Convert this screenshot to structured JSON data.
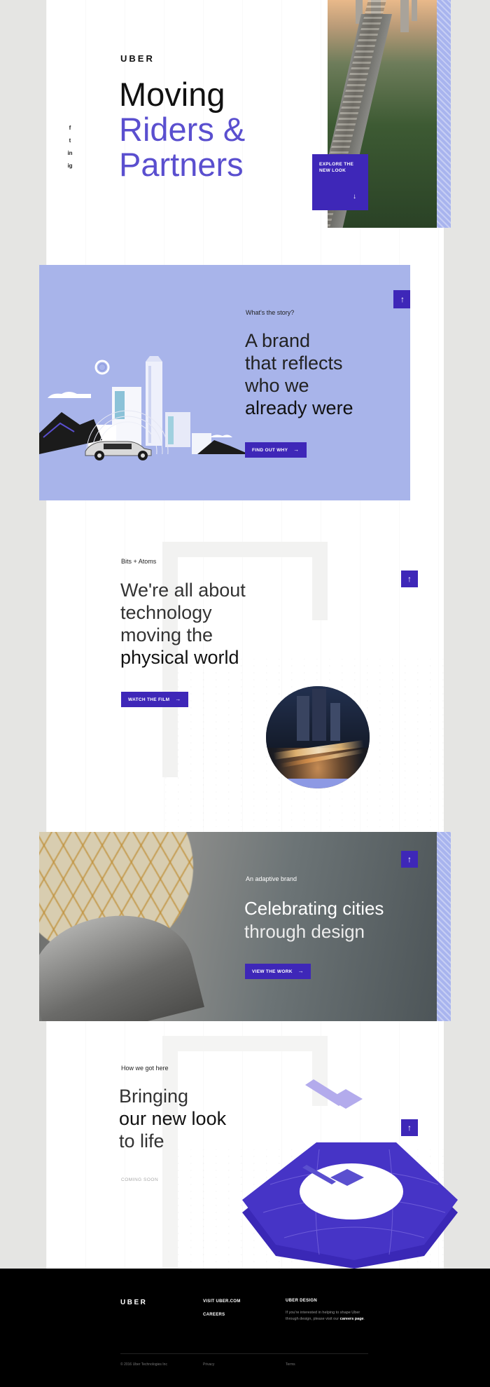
{
  "hero": {
    "brand": "UBER",
    "title_line1": "Moving",
    "title_line2": "Riders &",
    "title_line3": "Partners",
    "explore_label": "EXPLORE THE NEW LOOK",
    "explore_arrow": "↓",
    "social_icons": [
      "facebook-icon",
      "twitter-icon",
      "linkedin-icon",
      "instagram-icon"
    ],
    "social_glyphs": [
      "f",
      "t",
      "in",
      "ig"
    ]
  },
  "story": {
    "eyebrow": "What's the story?",
    "line1": "A brand",
    "line2": "that reflects",
    "line3": "who we",
    "line4": "already were",
    "button": "FIND OUT WHY",
    "arrow": "→",
    "up": "↑"
  },
  "tech": {
    "eyebrow": "Bits + Atoms",
    "line1": "We're all about",
    "line2": "technology",
    "line3": "moving the",
    "line4": "physical world",
    "button": "WATCH THE FILM",
    "arrow": "→",
    "up": "↑"
  },
  "adaptive": {
    "eyebrow": "An adaptive brand",
    "line1": "Celebrating cities",
    "line2": "through design",
    "button": "VIEW THE WORK",
    "arrow": "→",
    "up": "↑"
  },
  "history": {
    "eyebrow": "How we got here",
    "line1": "Bringing",
    "line2": "our new look",
    "line3": "to life",
    "coming_soon": "COMING SOON",
    "up": "↑"
  },
  "footer": {
    "logo": "UBER",
    "visit": "VISIT UBER.COM",
    "careers": "CAREERS",
    "design_title": "UBER DESIGN",
    "design_body_prefix": "If you're interested in helping to shape Uber through design, please visit our",
    "design_body_link": "careers page",
    "design_body_suffix": ".",
    "copyright": "© 2016 Uber Technologies Inc",
    "privacy": "Privacy",
    "terms": "Terms"
  },
  "colors": {
    "accent": "#3e27b8",
    "accent_text": "#5a4fcf",
    "periwinkle": "#a8b4ea",
    "footer_bg": "#000000",
    "page_bg": "#e5e5e3"
  }
}
